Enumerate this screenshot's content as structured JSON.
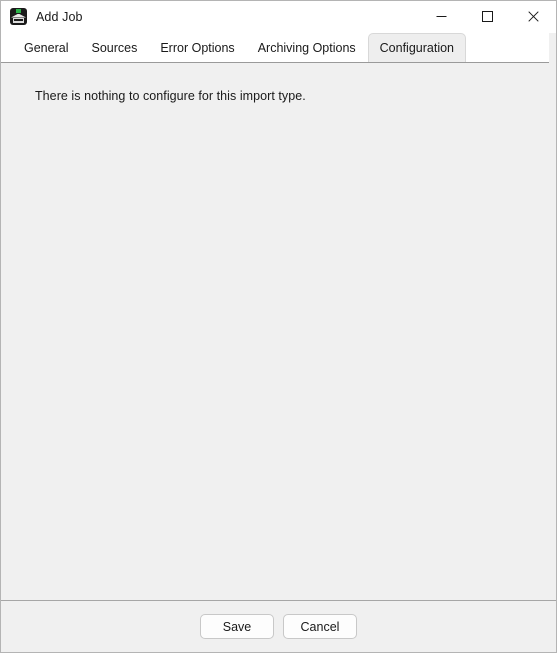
{
  "window": {
    "title": "Add Job",
    "icon": "app-icon",
    "controls": {
      "minimize_label": "Minimize",
      "maximize_label": "Maximize",
      "close_label": "Close"
    }
  },
  "tabs": [
    {
      "label": "General",
      "selected": false
    },
    {
      "label": "Sources",
      "selected": false
    },
    {
      "label": "Error Options",
      "selected": false
    },
    {
      "label": "Archiving Options",
      "selected": false
    },
    {
      "label": "Configuration",
      "selected": true
    }
  ],
  "content": {
    "message": "There is nothing to configure for this import type."
  },
  "footer": {
    "save_label": "Save",
    "cancel_label": "Cancel"
  },
  "colors": {
    "window_background": "#f0f0f0",
    "tabstrip_background": "#ffffff",
    "selected_tab_background": "#eeeeee",
    "text": "#1a1a1a",
    "border": "#c8c8c8",
    "separator": "#9a9a9a",
    "icon_accent": "#2cb34a",
    "close_hover": "#e81123"
  }
}
